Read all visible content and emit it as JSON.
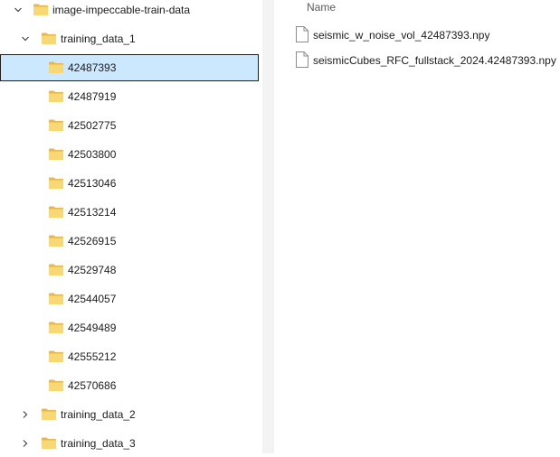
{
  "tree": {
    "root": {
      "label": "image-impeccable-train-data",
      "expanded": true
    },
    "parent": {
      "label": "training_data_1",
      "expanded": true
    },
    "children": [
      {
        "label": "42487393",
        "selected": true
      },
      {
        "label": "42487919"
      },
      {
        "label": "42502775"
      },
      {
        "label": "42503800"
      },
      {
        "label": "42513046"
      },
      {
        "label": "42513214"
      },
      {
        "label": "42526915"
      },
      {
        "label": "42529748"
      },
      {
        "label": "42544057"
      },
      {
        "label": "42549489"
      },
      {
        "label": "42555212"
      },
      {
        "label": "42570686"
      }
    ],
    "siblings": [
      {
        "label": "training_data_2",
        "expanded": false
      },
      {
        "label": "training_data_3",
        "expanded": false
      }
    ]
  },
  "content": {
    "column_name": "Name",
    "files": [
      {
        "name": "seismic_w_noise_vol_42487393.npy"
      },
      {
        "name": "seismicCubes_RFC_fullstack_2024.42487393.npy"
      }
    ]
  },
  "colors": {
    "folder": "#f8d775",
    "folder_tab": "#e8b64a",
    "selection_bg": "#cce8ff",
    "selection_border": "#1f1f1f",
    "pane_gap": "#f3f3f3"
  },
  "icons": {
    "folder": "folder-icon",
    "file": "file-icon",
    "expanded": "chevron-down-icon",
    "collapsed": "chevron-right-icon"
  }
}
